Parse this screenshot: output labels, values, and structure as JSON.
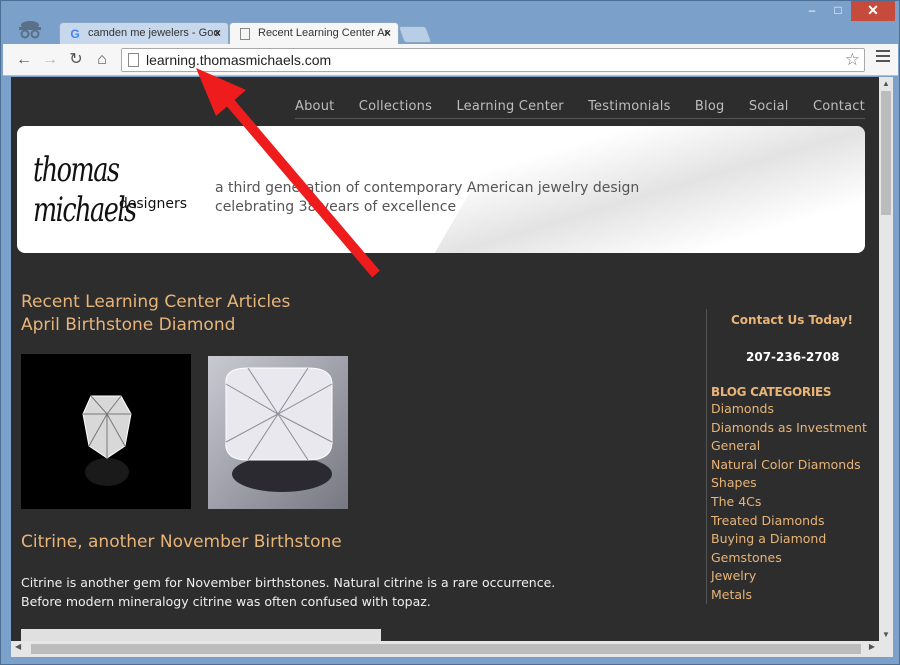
{
  "browser": {
    "tabs": [
      {
        "title": "camden me jewelers - Goo",
        "icon": "google-g-icon",
        "active": false
      },
      {
        "title": "Recent Learning Center Ar",
        "icon": "page-icon",
        "active": true
      }
    ],
    "url": "learning.thomasmichaels.com",
    "window_buttons": {
      "minimize": "–",
      "maximize": "□",
      "close": "✕"
    }
  },
  "site": {
    "nav": [
      "About",
      "Collections",
      "Learning Center",
      "Testimonials",
      "Blog",
      "Social",
      "Contact"
    ],
    "logo": {
      "line1": "thomas michaels",
      "line2": "designers"
    },
    "tagline": [
      "a third generation of contemporary American jewelry design",
      "celebrating 38 years of excellence"
    ],
    "main": {
      "heading_line1": "Recent Learning Center Articles",
      "heading_line2": "April Birthstone Diamond",
      "article_title": "Citrine, another November Birthstone",
      "article_body": "Citrine is another gem for November birthstones.  Natural citrine is a rare occurrence.  Before modern mineralogy citrine was often confused with topaz."
    },
    "sidebar": {
      "contact_label": "Contact Us Today!",
      "phone": "207-236-2708",
      "blog_categories_title": "BLOG CATEGORIES",
      "categories": [
        "Diamonds",
        "Diamonds as Investment",
        "General",
        "Natural Color Diamonds",
        "Shapes",
        "The 4Cs",
        "Treated Diamonds",
        "Buying a Diamond",
        "Gemstones",
        "Jewelry",
        "Metals"
      ]
    }
  },
  "colors": {
    "accent": "#e8b478",
    "page_bg": "#2d2d2d",
    "annotation": "#ee1c1c"
  }
}
